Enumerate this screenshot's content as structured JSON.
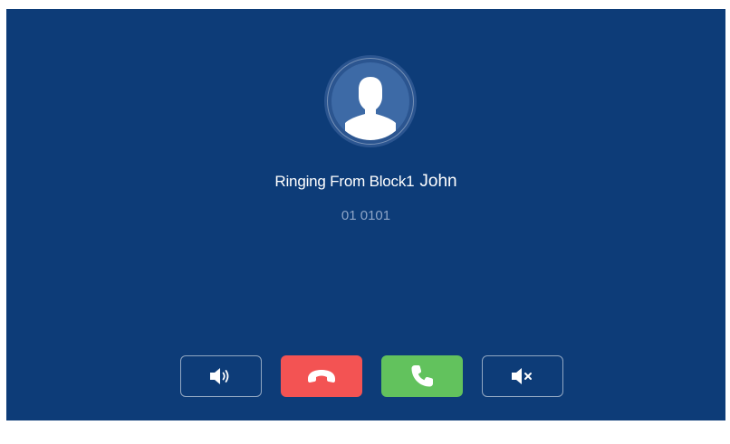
{
  "caller": {
    "prefix": "Ringing From Block1",
    "name": "John",
    "number": "01 0101"
  },
  "avatar": {
    "icon": "person-silhouette-icon"
  },
  "controls": [
    {
      "id": "speaker",
      "icon": "speaker-volume-icon"
    },
    {
      "id": "hangup",
      "icon": "phone-hangup-icon",
      "color": "#f35353"
    },
    {
      "id": "answer",
      "icon": "phone-answer-icon",
      "color": "#62c25d"
    },
    {
      "id": "mute",
      "icon": "speaker-mute-icon"
    }
  ],
  "colors": {
    "background": "#0d3c78",
    "hangup": "#f35353",
    "answer": "#62c25d"
  }
}
